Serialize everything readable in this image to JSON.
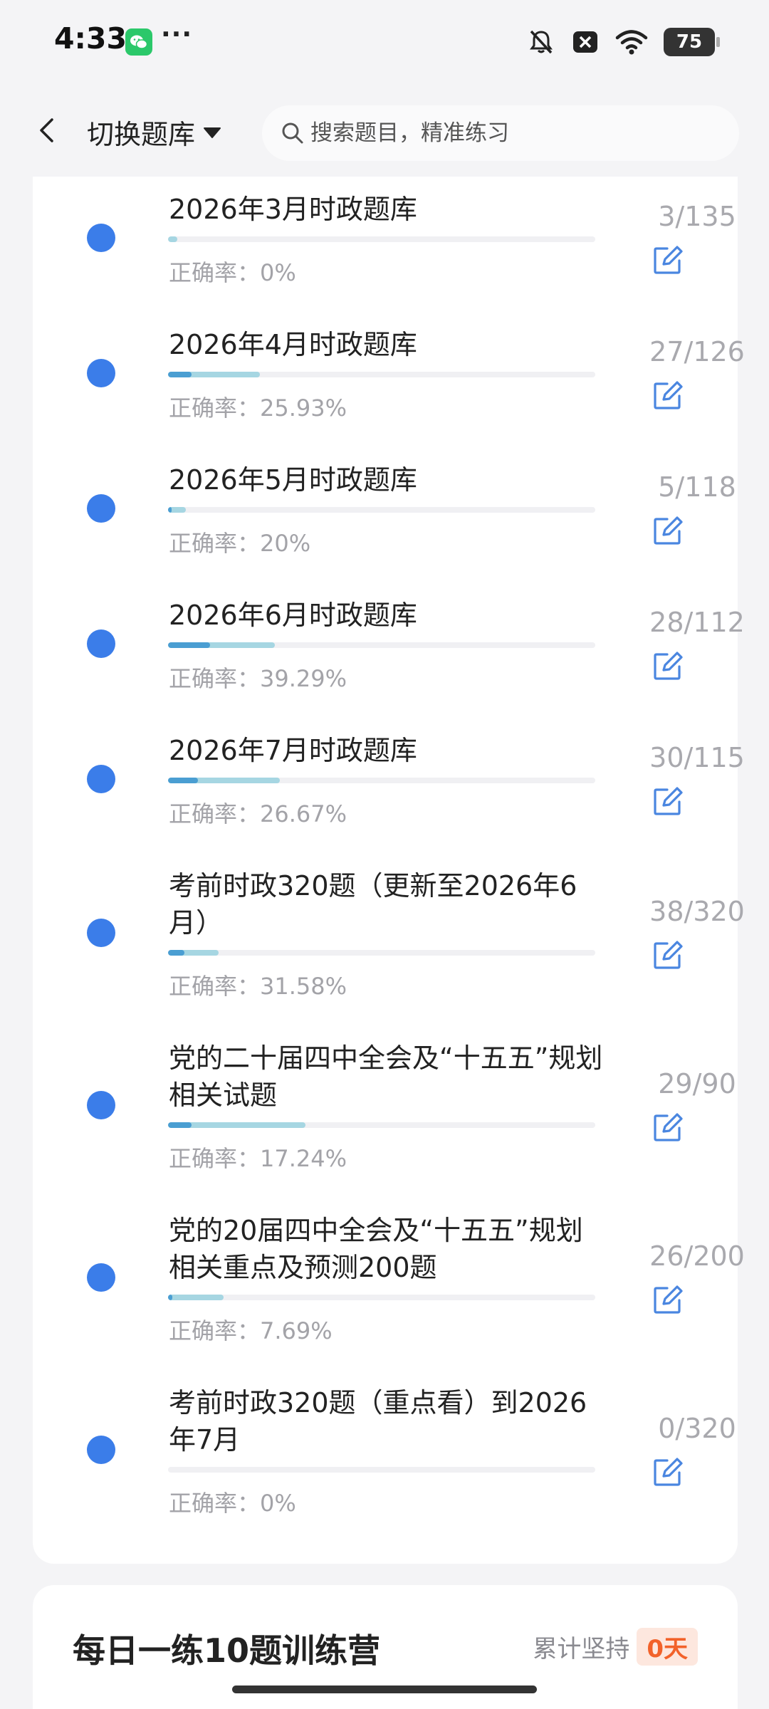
{
  "status_bar": {
    "time": "4:33",
    "dots": "···",
    "battery": "75",
    "icons": [
      "wechat-icon",
      "bell-muted-icon",
      "close-notification-icon",
      "wifi-icon",
      "battery-icon"
    ]
  },
  "nav": {
    "switch_label": "切换题库",
    "search_placeholder": "搜索题目，精准练习",
    "icons": [
      "back-icon",
      "caret-down-icon",
      "search-icon"
    ]
  },
  "question_banks": [
    {
      "title": "2026年3月时政题库",
      "accuracy_label": "正确率：0%",
      "answered": 3,
      "total": 135,
      "count_label": "3/135",
      "accuracy": 0
    },
    {
      "title": "2026年4月时政题库",
      "accuracy_label": "正确率：25.93%",
      "answered": 27,
      "total": 126,
      "count_label": "27/126",
      "accuracy": 25.93
    },
    {
      "title": "2026年5月时政题库",
      "accuracy_label": "正确率：20%",
      "answered": 5,
      "total": 118,
      "count_label": "5/118",
      "accuracy": 20
    },
    {
      "title": "2026年6月时政题库",
      "accuracy_label": "正确率：39.29%",
      "answered": 28,
      "total": 112,
      "count_label": "28/112",
      "accuracy": 39.29
    },
    {
      "title": "2026年7月时政题库",
      "accuracy_label": "正确率：26.67%",
      "answered": 30,
      "total": 115,
      "count_label": "30/115",
      "accuracy": 26.67
    },
    {
      "title": "考前时政320题（更新至2026年6月）",
      "accuracy_label": "正确率：31.58%",
      "answered": 38,
      "total": 320,
      "count_label": "38/320",
      "accuracy": 31.58
    },
    {
      "title": "党的二十届四中全会及“十五五”规划相关试题",
      "accuracy_label": "正确率：17.24%",
      "answered": 29,
      "total": 90,
      "count_label": "29/90",
      "accuracy": 17.24
    },
    {
      "title": "党的20届四中全会及“十五五”规划相关重点及预测200题",
      "accuracy_label": "正确率：7.69%",
      "answered": 26,
      "total": 200,
      "count_label": "26/200",
      "accuracy": 7.69
    },
    {
      "title": "考前时政320题（重点看）到2026年7月",
      "accuracy_label": "正确率：0%",
      "answered": 0,
      "total": 320,
      "count_label": "0/320",
      "accuracy": 0
    }
  ],
  "camp": {
    "title": "每日一练10题训练营",
    "streak_label": "累计坚持",
    "streak_value": "0天"
  },
  "colors": {
    "dot_blue": "#3b7de9",
    "progress_light": "#a6d6e2",
    "progress_dark": "#4a9ed2",
    "edit_icon_blue": "#4a86e0",
    "streak_orange": "#f2622a"
  }
}
